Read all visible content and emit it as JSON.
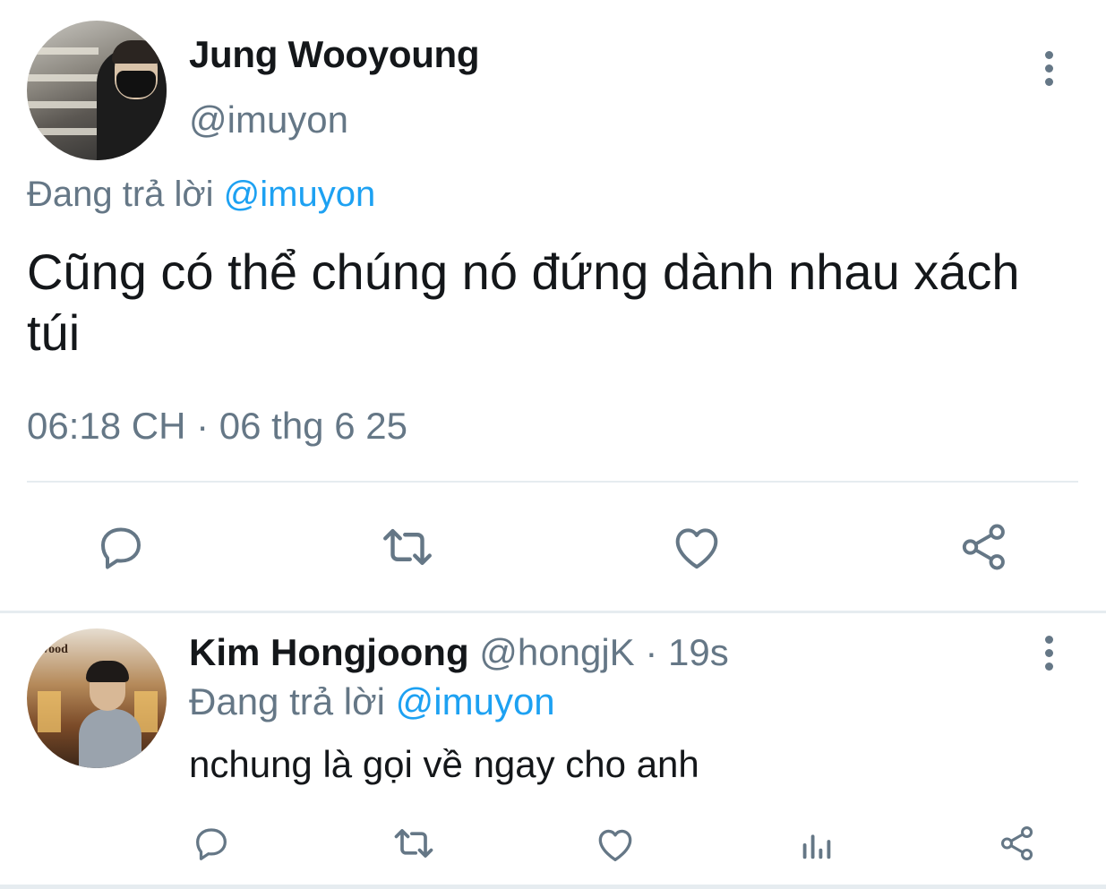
{
  "main_tweet": {
    "author_name": "Jung Wooyoung",
    "author_handle": "@imuyon",
    "replying_to_prefix": "Đang trả lời",
    "replying_to_handle": "@imuyon",
    "text": "Cũng có thể chúng nó đứng dành nhau xách túi",
    "timestamp": "06:18 CH · 06 thg 6 25",
    "actions": [
      "reply-icon",
      "retweet-icon",
      "like-icon",
      "share-icon"
    ]
  },
  "reply_tweet": {
    "author_name": "Kim Hongjoong",
    "author_handle": "@hongjK",
    "separator": " · ",
    "time_ago": "19s",
    "replying_to_prefix": "Đang trả lời",
    "replying_to_handle": "@imuyon",
    "text": "nchung là gọi về ngay cho anh",
    "actions": [
      "reply-icon",
      "retweet-icon",
      "like-icon",
      "analytics-icon",
      "share-icon"
    ],
    "avatar_sign_text": "wood"
  },
  "colors": {
    "text_primary": "#14171a",
    "text_secondary": "#657786",
    "accent": "#1da1f2",
    "divider": "#e6ecf0"
  }
}
